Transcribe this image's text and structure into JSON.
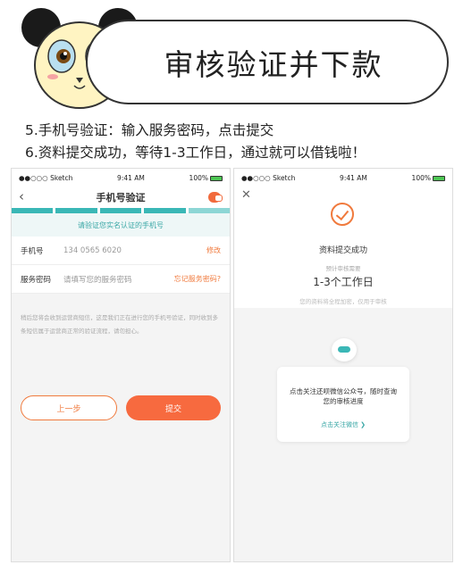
{
  "banner": {
    "title": "审核验证并下款"
  },
  "steps": [
    "5.手机号验证：输入服务密码，点击提交",
    "6.资料提交成功，等待1-3工作日，通过就可以借钱啦！"
  ],
  "status_bar": {
    "carrier": "●●○○○ Sketch",
    "time": "9:41 AM",
    "battery": "100%"
  },
  "left_screen": {
    "title": "手机号验证",
    "hint": "请验证您实名认证的手机号",
    "phone_label": "手机号",
    "phone_value": "134 0565 6020",
    "edit_link": "修改",
    "password_label": "服务密码",
    "password_placeholder": "请填写您的服务密码",
    "forgot_link": "忘记服务密码?",
    "notice": "稍后您将会收到运营商短信，这是我们正在进行您的手机号验证，同时收到多条短信属于运营商正常的验证流程，请勿担心。",
    "prev_button": "上一步",
    "submit_button": "提交"
  },
  "right_screen": {
    "success": "资料提交成功",
    "eta_label": "预计审核需要",
    "eta": "1-3个工作日",
    "secure": "您的资料将全程加密，仅用于审核",
    "wx_text": "点击关注还呗微信公众号，随时查询您的审核进度",
    "wx_link": "点击关注微信 ❯"
  },
  "colors": {
    "accent": "#f76a3f",
    "teal": "#3ab7b6"
  }
}
